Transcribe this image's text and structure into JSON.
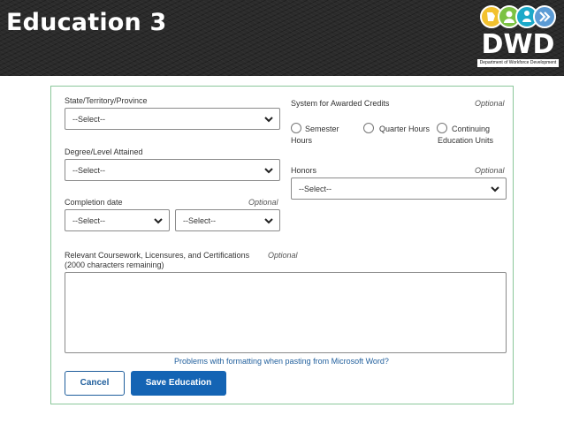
{
  "slide": {
    "title": "Education 3"
  },
  "logo": {
    "text": "DWD",
    "subtitle": "Department of Workforce Development",
    "colors": {
      "circle1": "#f2c12e",
      "circle2": "#7cc243",
      "circle3": "#1ba9c9",
      "circle4": "#5b9bd5"
    }
  },
  "form": {
    "state": {
      "label": "State/Territory/Province",
      "value": "--Select--"
    },
    "credits": {
      "label": "System for Awarded Credits",
      "optional": "Optional",
      "options": [
        "Semester",
        "Hours",
        "Quarter Hours",
        "Continuing",
        "Education Units"
      ]
    },
    "degree": {
      "label": "Degree/Level Attained",
      "value": "--Select--"
    },
    "honors": {
      "label": "Honors",
      "optional": "Optional",
      "value": "--Select--"
    },
    "completion": {
      "label": "Completion date",
      "optional": "Optional",
      "month_value": "--Select--",
      "year_value": "--Select--"
    },
    "coursework": {
      "label": "Relevant Coursework, Licensures, and Certifications",
      "optional": "Optional",
      "remaining": "(2000 characters remaining)",
      "value": ""
    },
    "help_link": "Problems with formatting when pasting from Microsoft Word?",
    "cancel_label": "Cancel",
    "save_label": "Save Education"
  },
  "colors": {
    "accent": "#1464b4",
    "panel_border": "#8bc79a",
    "header_bg": "#2b2b2b"
  }
}
